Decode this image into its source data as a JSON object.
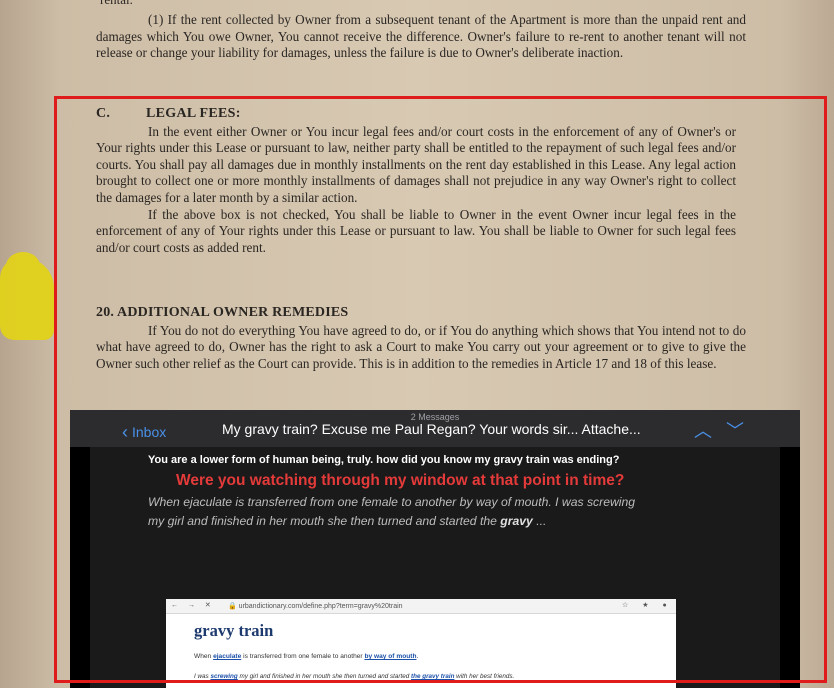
{
  "document": {
    "rental_fragment": "rental.",
    "intro_paragraph": "(1) If the rent collected by Owner from a subsequent tenant of the Apartment is more than the unpaid rent and damages which You owe Owner, You cannot receive the difference. Owner's failure to re-rent to another tenant will not release or change your liability for damages, unless the failure is due to Owner's deliberate inaction.",
    "section_c": {
      "letter": "C.",
      "title": "LEGAL FEES:",
      "paragraph1": "In the event either Owner or You incur legal fees and/or court costs in the enforcement of any of Owner's or Your rights under this Lease or pursuant to law, neither party shall be entitled to the repayment of such legal fees and/or courts. You shall pay all damages due in monthly installments on the rent day established in this Lease. Any legal action brought to collect one or more monthly installments of damages shall not prejudice in any way Owner's right to collect the damages for a later month by a similar action.",
      "paragraph2": "If the above box is not checked, You shall be liable to Owner in the event Owner incur legal fees in the enforcement of any of Your rights under this Lease or pursuant to law. You shall be liable to Owner for such legal fees and/or court costs as added rent."
    },
    "section_20": {
      "title": "20. ADDITIONAL OWNER REMEDIES",
      "paragraph": "If You do not do everything You have agreed to do, or if You do anything which shows that You intend not to do what have agreed to do, Owner has the right to ask a Court to make You carry out your agreement or to give to give the Owner such other relief as the Court can provide. This is in addition to the remedies in Article 17 and 18 of this lease."
    }
  },
  "mail": {
    "message_count": "2 Messages",
    "back_label": "Inbox",
    "subject": "My gravy train? Excuse me Paul Regan? Your words sir... Attache...",
    "up_icon": "chevron-up-icon",
    "down_icon": "chevron-down-icon",
    "body_line1": "You are a lower form of human being, truly. how did you know my gravy train was ending?",
    "body_line2": "Were you watching through my window at that point in time?",
    "body_line3_a": "When ejaculate is transferred from one female to another by way of mouth. I was screwing my girl and finished in her mouth she then turned and started the ",
    "body_line3_bold": "gravy",
    "body_line3_b": " ..."
  },
  "browser": {
    "url": "urbandictionary.com/define.php?term=gravy%20train",
    "title": "gravy train",
    "def_pre": "When ",
    "def_link1": "ejaculate",
    "def_mid": " is transferred from one female to another ",
    "def_link2": "by way of mouth",
    "def_post": ".",
    "ex_pre": "I was ",
    "ex_link1": "screwing",
    "ex_mid": " my girl and finished in her mouth she then turned and started ",
    "ex_link2": "the gravy train",
    "ex_post": " with her best friends."
  },
  "colors": {
    "annotation_box": "#e01b1b",
    "highlighter": "#e2d21a",
    "ios_accent": "#4a90e8",
    "emphasis_red": "#e43a3a"
  }
}
